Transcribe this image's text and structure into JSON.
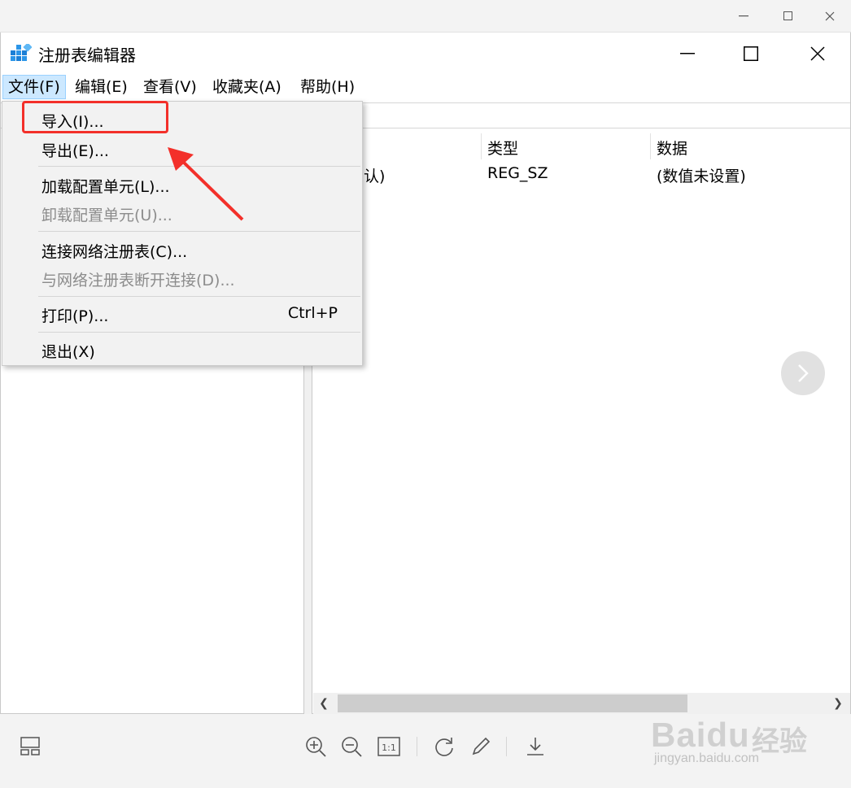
{
  "window": {
    "title": "注册表编辑器"
  },
  "menubar": {
    "items": [
      {
        "label": "文件(F)"
      },
      {
        "label": "编辑(E)"
      },
      {
        "label": "查看(V)"
      },
      {
        "label": "收藏夹(A)"
      },
      {
        "label": "帮助(H)"
      }
    ]
  },
  "file_menu": {
    "items": [
      {
        "label": "导入(I)...",
        "enabled": true
      },
      {
        "label": "导出(E)...",
        "enabled": true
      },
      {
        "label": "加载配置单元(L)...",
        "enabled": true
      },
      {
        "label": "卸载配置单元(U)...",
        "enabled": false
      },
      {
        "label": "连接网络注册表(C)...",
        "enabled": true
      },
      {
        "label": "与网络注册表断开连接(D)...",
        "enabled": false
      },
      {
        "label": "打印(P)...",
        "shortcut": "Ctrl+P",
        "enabled": true
      },
      {
        "label": "退出(X)",
        "enabled": true
      }
    ]
  },
  "list": {
    "columns": [
      "类型",
      "数据"
    ],
    "rows": [
      {
        "name_partial": "认)",
        "type": "REG_SZ",
        "data": "(数值未设置)"
      }
    ]
  },
  "watermark": {
    "brand": "Baidu",
    "jingyan": "经验",
    "url": "jingyan.baidu.com"
  },
  "colors": {
    "highlight": "#f3302a",
    "menu_active_bg": "#cce8ff",
    "menu_bg": "#f2f2f2"
  }
}
